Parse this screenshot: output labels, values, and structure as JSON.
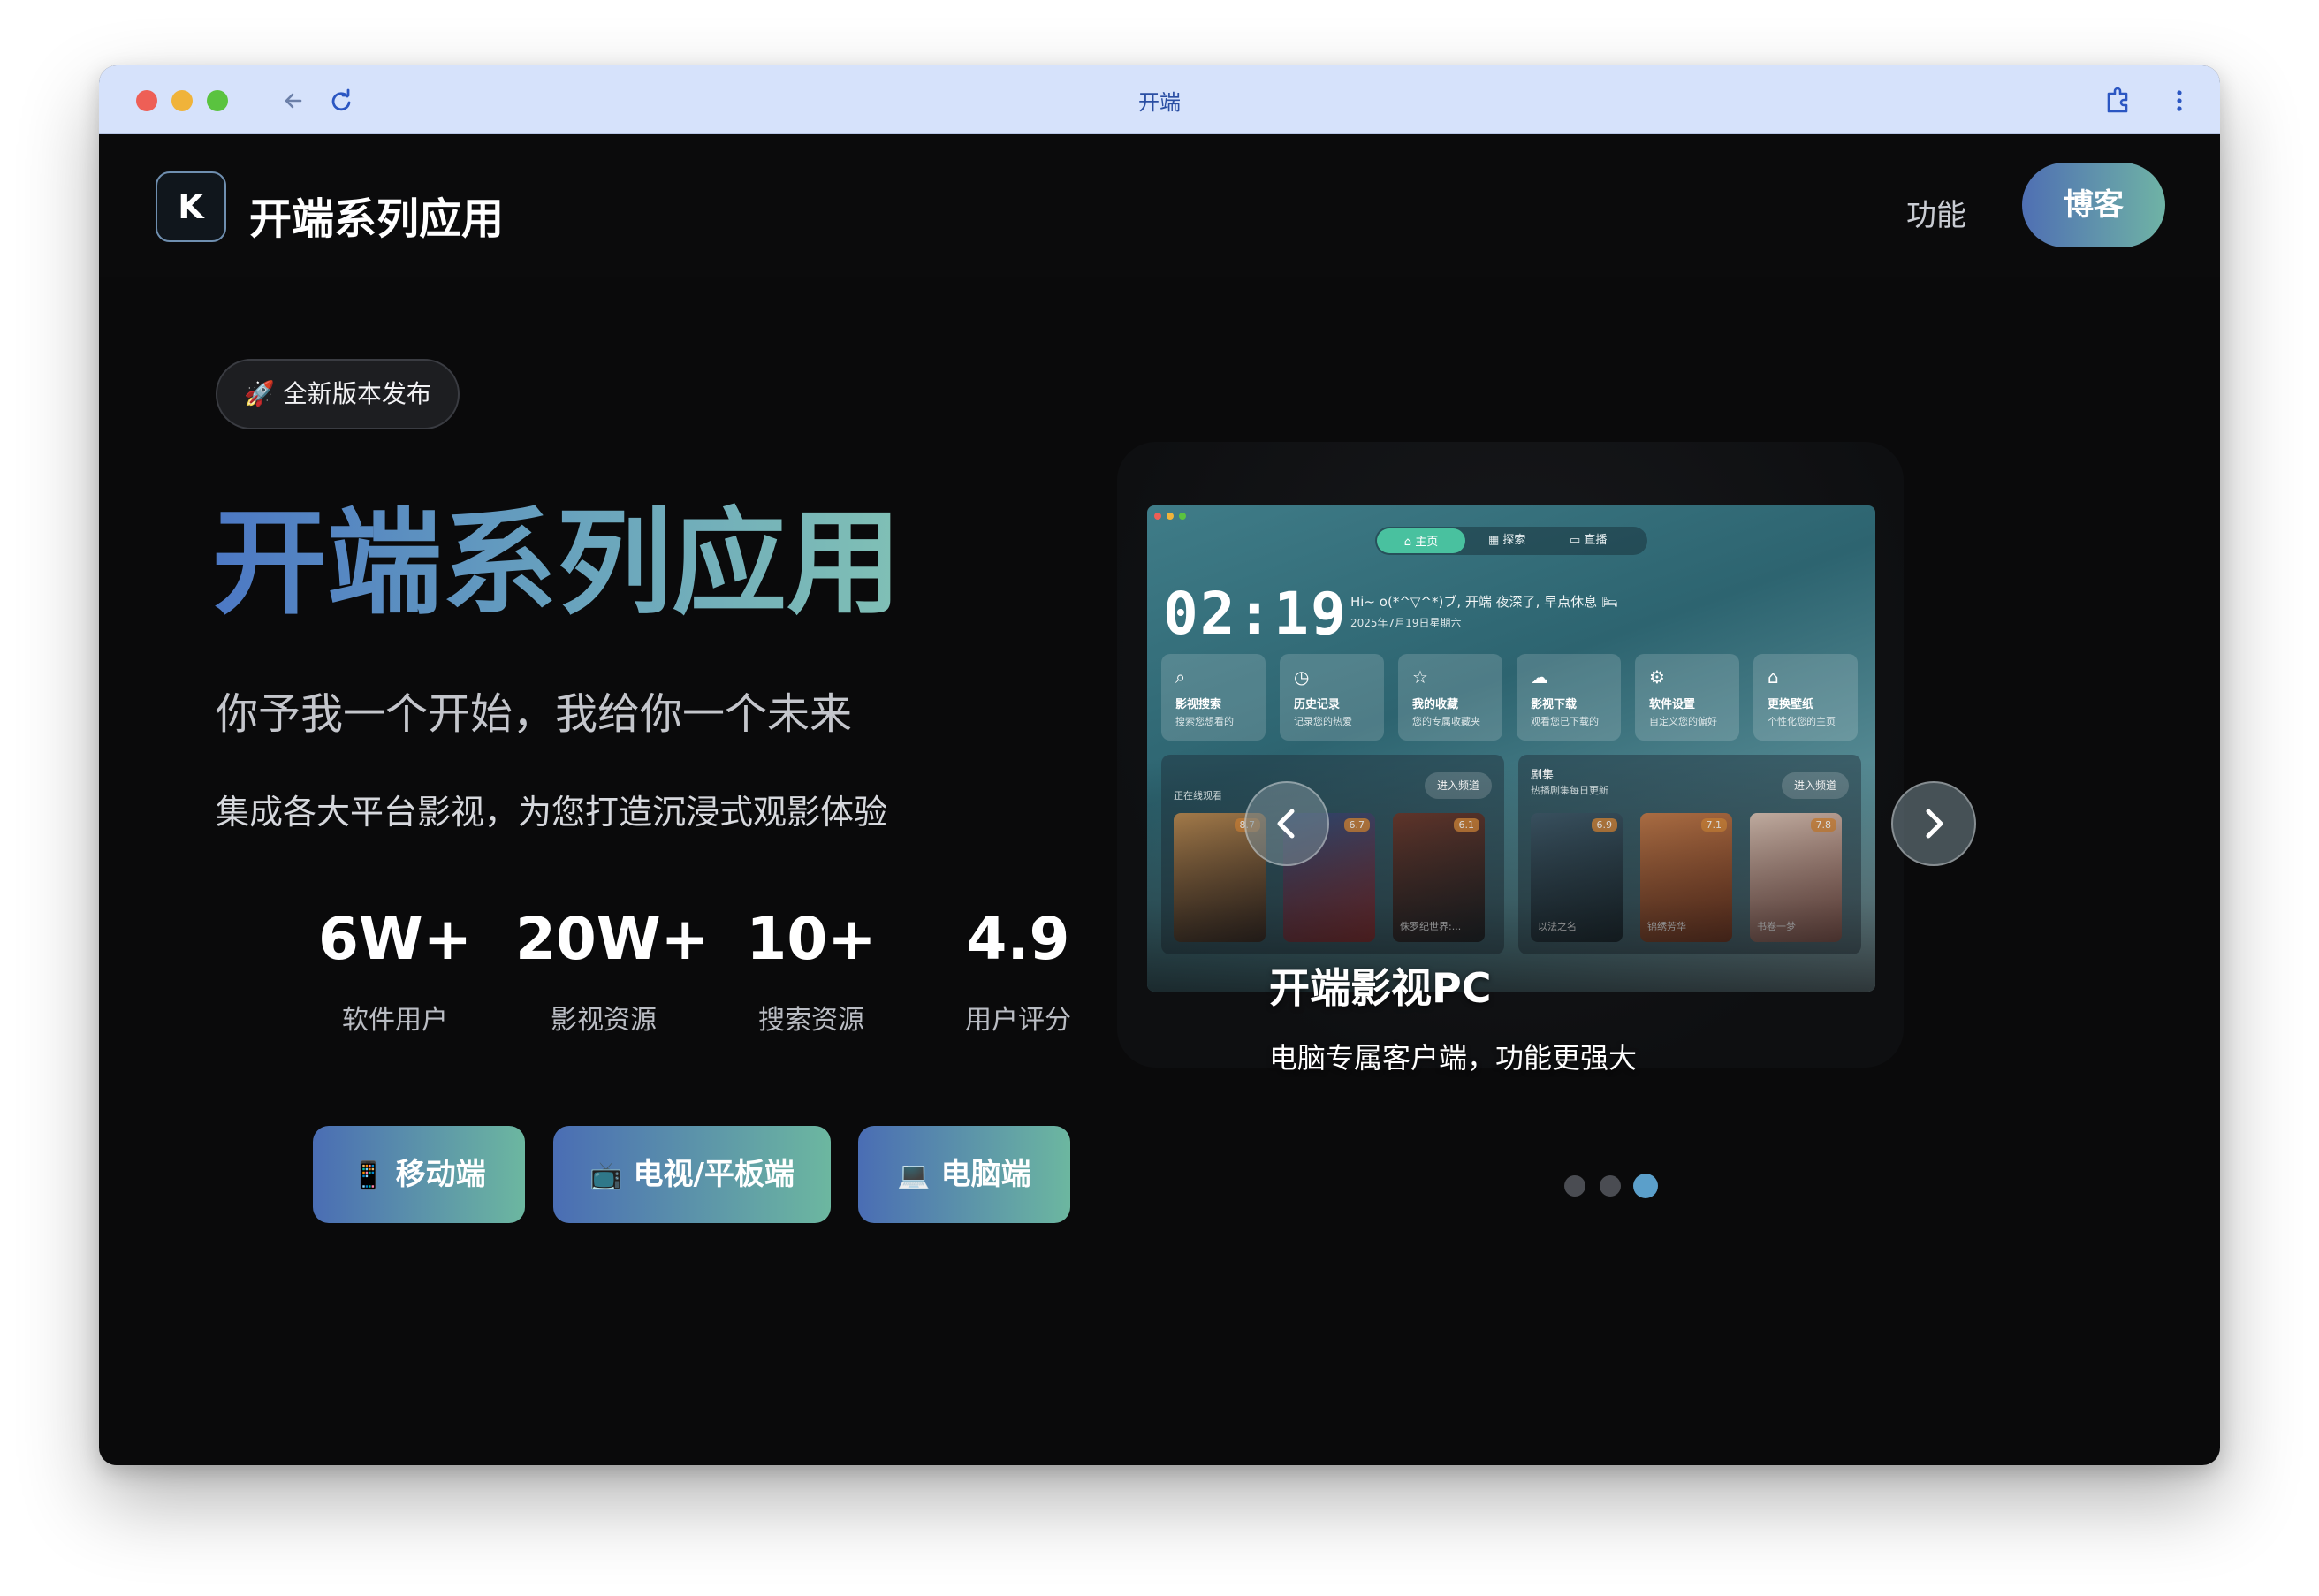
{
  "browser": {
    "tab_title": "开端"
  },
  "header": {
    "logo_letter": "K",
    "brand": "开端系列应用",
    "nav_features": "功能",
    "blog_button": "博客"
  },
  "hero": {
    "badge": "🚀 全新版本发布",
    "title": "开端系列应用",
    "slogan": "你予我一个开始，我给你一个未来",
    "description": "集成各大平台影视，为您打造沉浸式观影体验",
    "stats": [
      {
        "value": "6W+",
        "label": "软件用户"
      },
      {
        "value": "20W+",
        "label": "影视资源"
      },
      {
        "value": "10+",
        "label": "搜索资源"
      },
      {
        "value": "4.9",
        "label": "用户评分"
      }
    ],
    "buttons": [
      {
        "icon": "📱",
        "label": "移动端"
      },
      {
        "icon": "📺",
        "label": "电视/平板端"
      },
      {
        "icon": "💻",
        "label": "电脑端"
      }
    ]
  },
  "showcase": {
    "mini_app": {
      "nav": [
        "主页",
        "探索",
        "直播"
      ],
      "clock": "02:19",
      "greeting": "Hi~ o(*^▽^*)ブ, 开端 夜深了, 早点休息 🛏",
      "date": "2025年7月19日星期六",
      "features": [
        {
          "title": "影视搜索",
          "sub": "搜索您想看的"
        },
        {
          "title": "历史记录",
          "sub": "记录您的热爱"
        },
        {
          "title": "我的收藏",
          "sub": "您的专属收藏夹"
        },
        {
          "title": "影视下载",
          "sub": "观看您已下载的"
        },
        {
          "title": "软件设置",
          "sub": "自定义您的偏好"
        },
        {
          "title": "更换壁纸",
          "sub": "个性化您的主页"
        }
      ],
      "panel_left": {
        "sub": "正在线观看",
        "enter": "进入频道",
        "posters": [
          {
            "score": "8.7",
            "name": ""
          },
          {
            "score": "6.7",
            "name": ""
          },
          {
            "score": "6.1",
            "name": "侏罗纪世界:..."
          }
        ]
      },
      "panel_right": {
        "head": "剧集",
        "sub": "热播剧集每日更新",
        "enter": "进入频道",
        "posters": [
          {
            "score": "6.9",
            "name": "以法之名"
          },
          {
            "score": "7.1",
            "name": "锦绣芳华"
          },
          {
            "score": "7.8",
            "name": "书卷一梦"
          }
        ]
      }
    },
    "slide_title": "开端影视PC",
    "slide_subtitle": "电脑专属客户端，功能更强大",
    "carousel_total": 3,
    "carousel_active": 3
  },
  "colors": {
    "accent_start": "#4a6db4",
    "accent_end": "#6cb7a0",
    "page_bg": "#0a0a0b",
    "chrome_bg": "#d6e2fb"
  }
}
